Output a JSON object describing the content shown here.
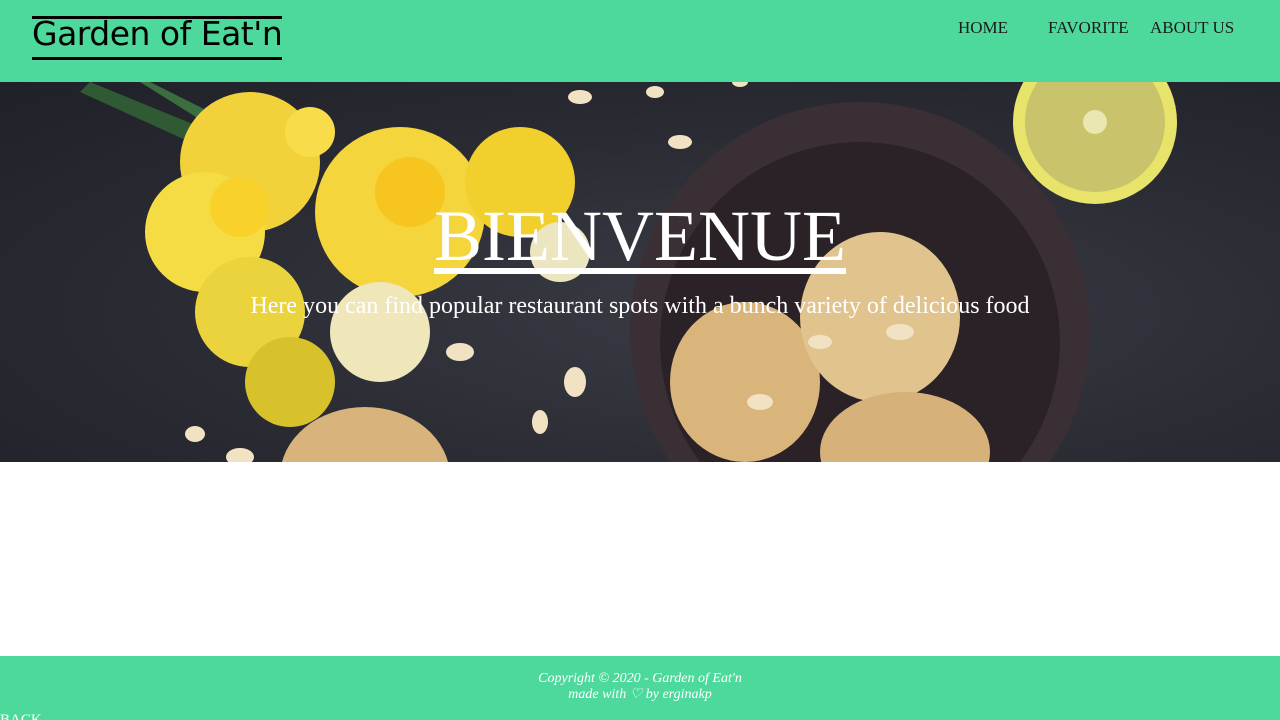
{
  "header": {
    "brand": "Garden of Eat'n",
    "nav": [
      "HOME",
      "FAVORITE",
      "ABOUT US"
    ]
  },
  "hero": {
    "title": "BIENVENUE",
    "subtitle": "Here you can find popular restaurant spots with a bunch variety of delicious food"
  },
  "footer": {
    "copyright": "Copyright © 2020 - Garden of Eat'n",
    "made_with": "made with ♡ by erginakp"
  },
  "back_link": "BACK",
  "colors": {
    "accent": "#4ed99c",
    "hero_bg": "#2a2b33"
  }
}
